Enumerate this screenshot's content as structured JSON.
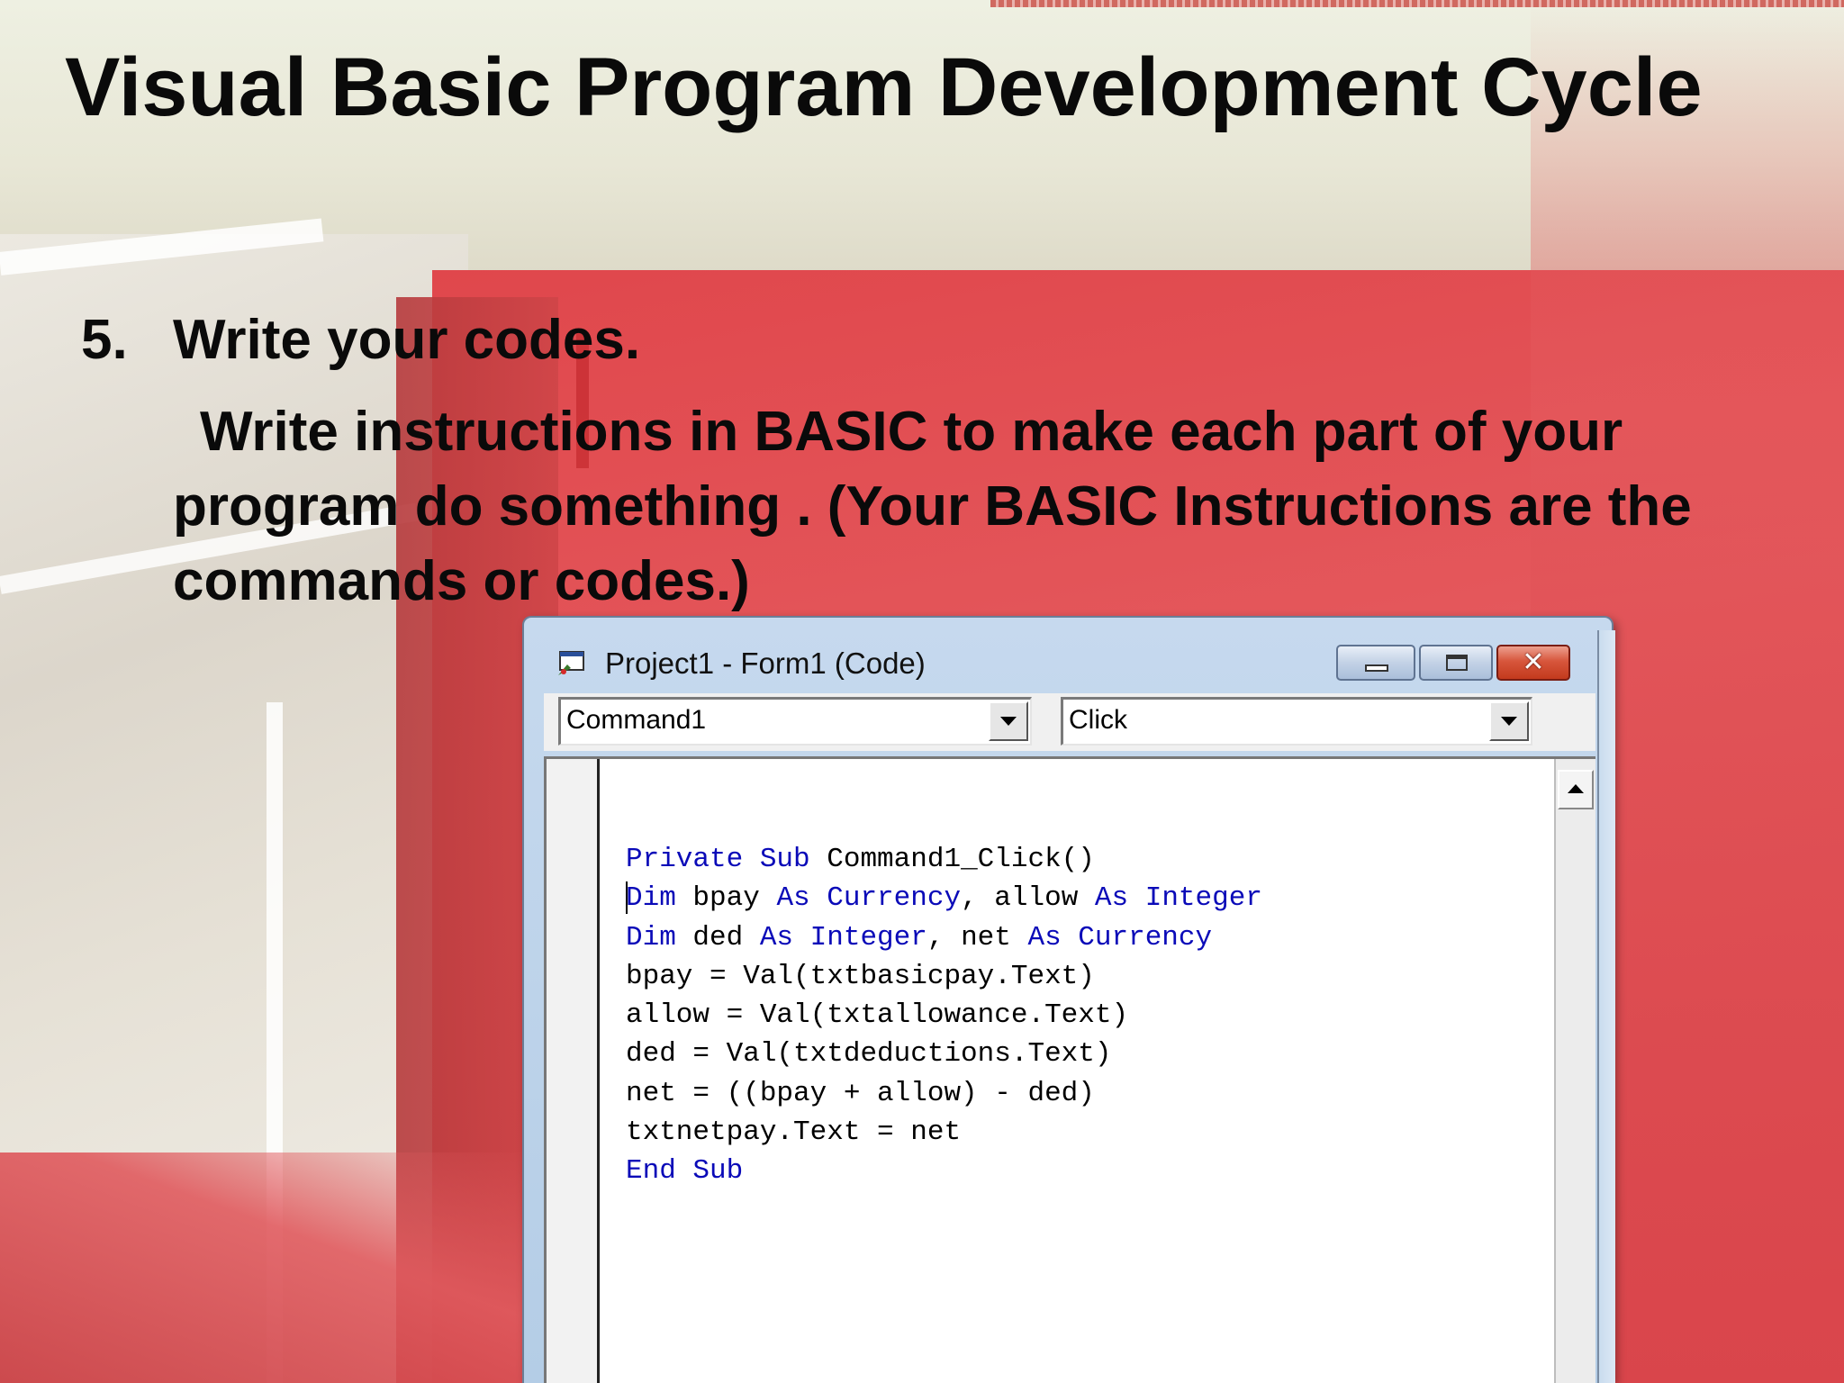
{
  "slide": {
    "title": "Visual Basic Program Development Cycle",
    "step_number": "5.",
    "step_heading": "Write your codes.",
    "step_body": "Write instructions in BASIC to make each part of your program do something . (Your BASIC Instructions are the commands or codes.)"
  },
  "code_window": {
    "title": "Project1 - Form1 (Code)",
    "icon": "vb-code-window-icon",
    "object_dropdown": {
      "value": "Command1"
    },
    "procedure_dropdown": {
      "value": "Click"
    },
    "code_lines": [
      [
        {
          "t": "Private Sub",
          "k": true
        },
        {
          "t": " Command1_Click()",
          "k": false
        }
      ],
      [
        {
          "t": "Dim",
          "k": true
        },
        {
          "t": " bpay ",
          "k": false
        },
        {
          "t": "As Currency",
          "k": true
        },
        {
          "t": ", allow ",
          "k": false
        },
        {
          "t": "As Integer",
          "k": true
        }
      ],
      [
        {
          "t": "Dim",
          "k": true
        },
        {
          "t": " ded ",
          "k": false
        },
        {
          "t": "As Integer",
          "k": true
        },
        {
          "t": ", net ",
          "k": false
        },
        {
          "t": "As Currency",
          "k": true
        }
      ],
      [
        {
          "t": "bpay = Val(txtbasicpay.Text)",
          "k": false
        }
      ],
      [
        {
          "t": "allow = Val(txtallowance.Text)",
          "k": false
        }
      ],
      [
        {
          "t": "ded = Val(txtdeductions.Text)",
          "k": false
        }
      ],
      [
        {
          "t": "net = ((bpay + allow) - ded)",
          "k": false
        }
      ],
      [
        {
          "t": "txtnetpay.Text = net",
          "k": false
        }
      ],
      [
        {
          "t": "End Sub",
          "k": true
        }
      ]
    ],
    "keyword_color": "#0a0ab8",
    "text_color": "#000000"
  },
  "colors": {
    "slide_red": "#e0474c",
    "title_text": "#0a0a0a"
  }
}
